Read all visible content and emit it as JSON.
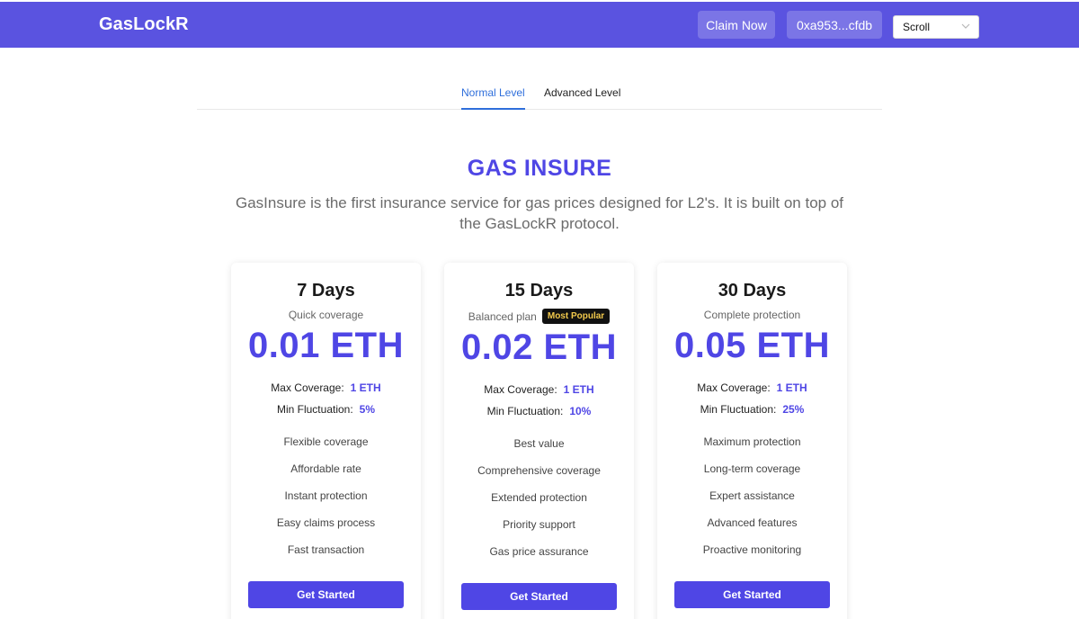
{
  "header": {
    "brand": "GasLockR",
    "claim_label": "Claim Now",
    "wallet_label": "0xa953...cfdb",
    "network_select": "Scroll"
  },
  "tabs": [
    {
      "label": "Normal Level",
      "active": true
    },
    {
      "label": "Advanced Level",
      "active": false
    }
  ],
  "hero": {
    "title": "GAS INSURE",
    "description": "GasInsure is the first insurance service for gas prices designed for L2's. It is built on top of the GasLockR protocol."
  },
  "plans": [
    {
      "duration": "7 Days",
      "subtitle": "Quick coverage",
      "badge": "",
      "price": "0.01 ETH",
      "max_coverage_label": "Max Coverage:",
      "max_coverage_value": "1 ETH",
      "min_fluctuation_label": "Min Fluctuation:",
      "min_fluctuation_value": "5%",
      "features": [
        "Flexible coverage",
        "Affordable rate",
        "Instant protection",
        "Easy claims process",
        "Fast transaction"
      ],
      "cta": "Get Started"
    },
    {
      "duration": "15 Days",
      "subtitle": "Balanced plan",
      "badge": "Most Popular",
      "price": "0.02 ETH",
      "max_coverage_label": "Max Coverage:",
      "max_coverage_value": "1 ETH",
      "min_fluctuation_label": "Min Fluctuation:",
      "min_fluctuation_value": "10%",
      "features": [
        "Best value",
        "Comprehensive coverage",
        "Extended protection",
        "Priority support",
        "Gas price assurance"
      ],
      "cta": "Get Started"
    },
    {
      "duration": "30 Days",
      "subtitle": "Complete protection",
      "badge": "",
      "price": "0.05 ETH",
      "max_coverage_label": "Max Coverage:",
      "max_coverage_value": "1 ETH",
      "min_fluctuation_label": "Min Fluctuation:",
      "min_fluctuation_value": "25%",
      "features": [
        "Maximum protection",
        "Long-term coverage",
        "Expert assistance",
        "Advanced features",
        "Proactive monitoring"
      ],
      "cta": "Get Started"
    }
  ],
  "colors": {
    "navbar": "#5a53e0",
    "accent": "#4f46e5",
    "tab_active": "#2f6fdb",
    "badge_bg": "#111111",
    "badge_text": "#f2c94c"
  },
  "icons": {
    "select_chevron": "chevron-down-icon"
  }
}
